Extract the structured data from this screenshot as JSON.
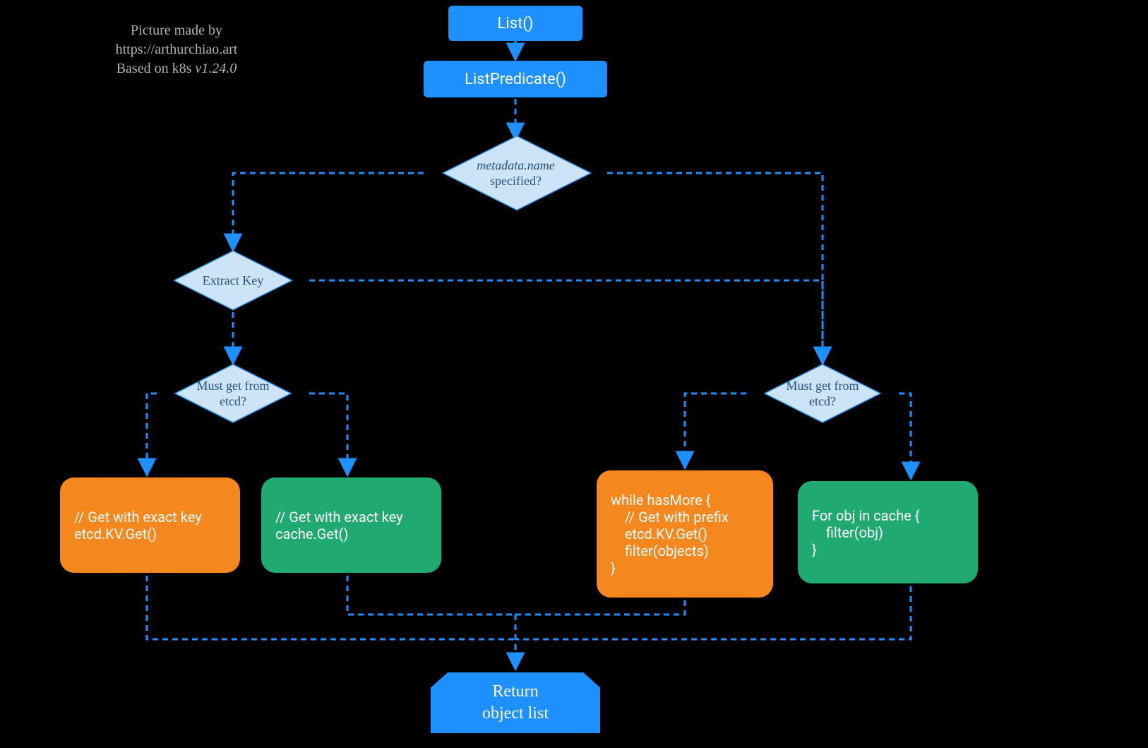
{
  "attribution": {
    "line1": "Picture made by",
    "line2": "https://arthurchiao.art",
    "line3": "Based on k8s v1.24.0"
  },
  "nodes": {
    "list": "List()",
    "listPredicate": "ListPredicate()",
    "metaQ_em": "metadata.name",
    "metaQ_rest": "specified?",
    "extractKey": "Extract Key",
    "mustEtcdL": "Must get from\netcd?",
    "mustEtcdR": "Must get from\netcd?",
    "orangeL": "// Get with exact key\netcd.KV.Get()",
    "greenL": "// Get with exact key\ncache.Get()",
    "orangeR": "while hasMore {\n    // Get with prefix\n    etcd.KV.Get()\n    filter(objects)\n}",
    "greenR": "For obj in cache {\n    filter(obj)\n}",
    "return": "Return\nobject list"
  },
  "colors": {
    "blue": "#1e90ff",
    "lightblue": "#cde3f8",
    "orange": "#f5871f",
    "green": "#20a971"
  }
}
